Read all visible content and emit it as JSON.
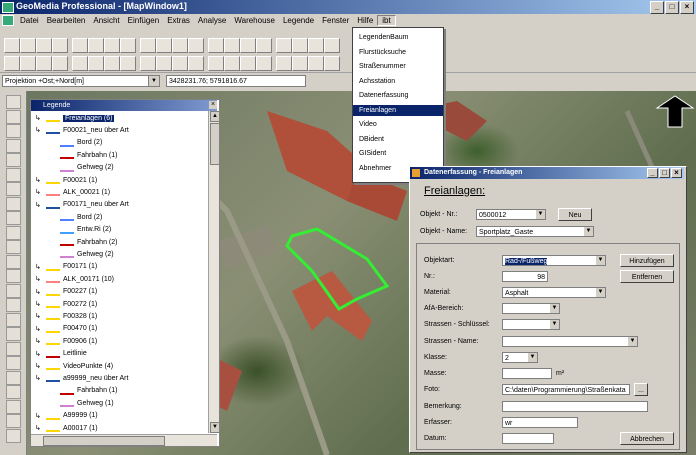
{
  "window": {
    "title": "GeoMedia Professional - [MapWindow1]"
  },
  "menubar": [
    "Datei",
    "Bearbeiten",
    "Ansicht",
    "Einfügen",
    "Extras",
    "Analyse",
    "Warehouse",
    "Legende",
    "Fenster",
    "Hilfe",
    "ibt"
  ],
  "projection": {
    "select": "Projektion +Ost;+Nord[m]",
    "coords": "3428231.76; 5791816.67"
  },
  "legend": {
    "title": "Legende",
    "items": [
      {
        "label": "Freianlagen (6)",
        "color": "#ffd700"
      },
      {
        "label": "F00021_neu über Art",
        "color": "#2050a0"
      },
      {
        "label": "Bord (2)",
        "color": "#5080ff"
      },
      {
        "label": "Fahrbahn (1)",
        "color": "#c00000"
      },
      {
        "label": "Gehweg (2)",
        "color": "#d080d0"
      },
      {
        "label": "F00021 (1)",
        "color": "#ffd700"
      },
      {
        "label": "ALK_00021 (1)",
        "color": "#ff8080"
      },
      {
        "label": "F00171_neu über Art",
        "color": "#2050a0"
      },
      {
        "label": "Bord (2)",
        "color": "#5080ff"
      },
      {
        "label": "Entw.Ri (2)",
        "color": "#40a0ff"
      },
      {
        "label": "Fahrbahn (2)",
        "color": "#c00000"
      },
      {
        "label": "Gehweg (2)",
        "color": "#d080d0"
      },
      {
        "label": "F00171 (1)",
        "color": "#ffd700"
      },
      {
        "label": "ALK_00171 (10)",
        "color": "#ff8080"
      },
      {
        "label": "F00227 (1)",
        "color": "#ffd700"
      },
      {
        "label": "F00272 (1)",
        "color": "#ffd700"
      },
      {
        "label": "F00328 (1)",
        "color": "#ffd700"
      },
      {
        "label": "F00470 (1)",
        "color": "#ffd700"
      },
      {
        "label": "F00906 (1)",
        "color": "#ffd700"
      },
      {
        "label": "Leitlinie",
        "color": "#c00000"
      },
      {
        "label": "VideoPunkte (4)",
        "color": "#ffd700"
      },
      {
        "label": "a99999_neu über Art",
        "color": "#2050a0"
      },
      {
        "label": "Fahrbahn (1)",
        "color": "#c00000"
      },
      {
        "label": "Gehweg (1)",
        "color": "#d080d0"
      },
      {
        "label": "A99999 (1)",
        "color": "#ffd700"
      },
      {
        "label": "A00017 (1)",
        "color": "#ffd700"
      }
    ]
  },
  "dropdown": {
    "items": [
      "LegendenBaum",
      "Flurstücksuche",
      "Straßenummer",
      "Achsstation",
      "Datenerfassung",
      "Freianlagen",
      "Video",
      "DBident",
      "GISident",
      "Abnehmer"
    ],
    "highlighted": "Freianlagen"
  },
  "dialog": {
    "title": "Datenerfassung - Freianlagen",
    "heading": "Freianlagen:",
    "objekt_nr_label": "Objekt - Nr.:",
    "objekt_nr_value": "0500012",
    "neu_button": "Neu",
    "objekt_name_label": "Objekt - Name:",
    "objekt_name_value": "Sportplatz_Gaste",
    "fields": {
      "objektart_label": "Objektart:",
      "objektart_value": "Rad-/Fußweg",
      "nr_label": "Nr.:",
      "nr_value": "98",
      "material_label": "Material:",
      "material_value": "Asphalt",
      "afa_label": "AfA-Bereich:",
      "strassen_schluessel_label": "Strassen - Schlüssel:",
      "strassen_name_label": "Strassen - Name:",
      "klasse_label": "Klasse:",
      "klasse_value": "2",
      "masse_label": "Masse:",
      "masse_unit": "m²",
      "foto_label": "Foto:",
      "foto_value": "C:\\daten\\Programmierung\\Straßenkata",
      "foto_browse": "...",
      "bemerkung_label": "Bemerkung:",
      "erfasser_label": "Erfasser:",
      "erfasser_value": "wr",
      "datum_label": "Datum:"
    },
    "buttons": {
      "hinzufuegen": "Hinzufügen",
      "entfernen": "Entfernen",
      "abbrechen": "Abbrechen"
    }
  }
}
